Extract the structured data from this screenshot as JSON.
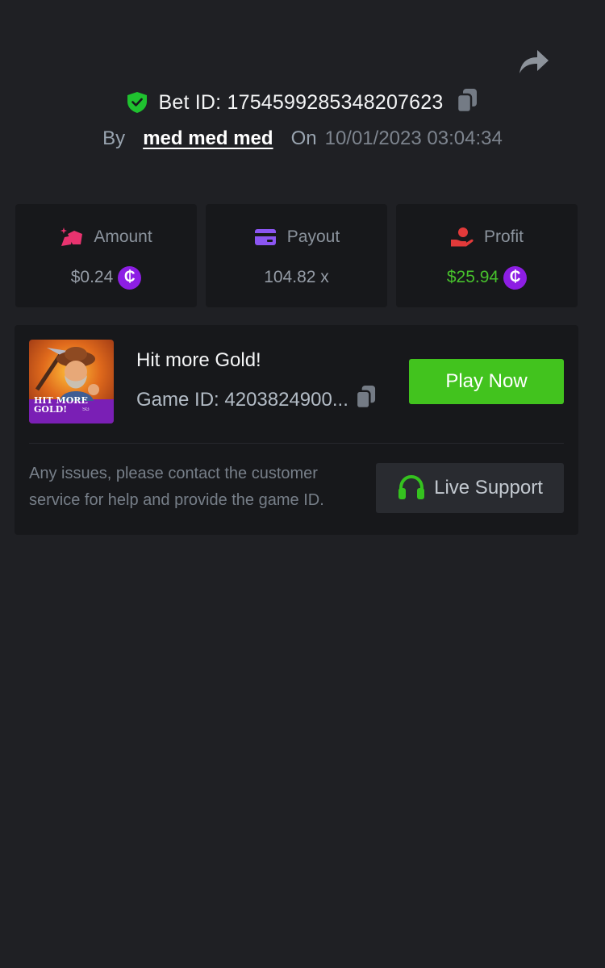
{
  "header": {
    "share_icon": "share-arrow-icon",
    "bet_id_label": "Bet ID:",
    "bet_id": "1754599285348207623",
    "by_label": "By",
    "username": "med med med",
    "on_label": "On",
    "date": "10/01/2023 03:04:34"
  },
  "stats": {
    "amount": {
      "label": "Amount",
      "value": "$0.24",
      "icon": "gold-bars-icon"
    },
    "payout": {
      "label": "Payout",
      "value": "104.82 x",
      "icon": "card-icon"
    },
    "profit": {
      "label": "Profit",
      "value": "$25.94",
      "icon": "coin-hand-icon"
    },
    "currency_symbol": "₵"
  },
  "game": {
    "title": "Hit more Gold!",
    "id_label": "Game ID:",
    "id": "4203824900...",
    "thumbnail_text": [
      "HIT MORE",
      "GOLD!"
    ],
    "thumbnail_brand": "SG",
    "play_label": "Play Now",
    "help_text": "Any issues, please contact the customer service for help and provide the game ID.",
    "support_label": "Live Support"
  },
  "colors": {
    "background": "#1f2024",
    "card": "#17181b",
    "accent_green": "#42c31e",
    "profit_green": "#47c12c",
    "coin_purple": "#8d1ee4",
    "amount_pink": "#e8336f",
    "payout_purple": "#8b55f2",
    "profit_red": "#e23a3a"
  }
}
